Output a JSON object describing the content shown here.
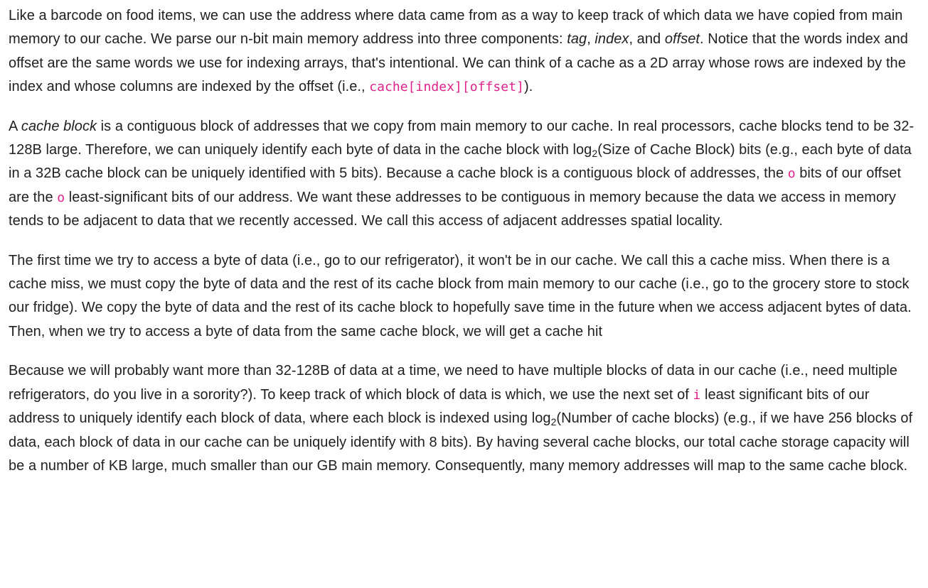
{
  "paragraphs": [
    {
      "p1_a": "Like a barcode on food items, we can use the address where data came from as a way to keep track of which data we have copied from main memory to our cache. We parse our n-bit main memory address into three components: ",
      "p1_tag": "tag",
      "p1_b": ", ",
      "p1_index": "index",
      "p1_c": ", and ",
      "p1_offset": "offset",
      "p1_d": ". Notice that the words index and offset are the same words we use for indexing arrays, that's intentional. We can think of a cache as a 2D array whose rows are indexed by the index and whose columns are indexed by the offset (i.e., ",
      "p1_code": "cache[index][offset]",
      "p1_e": ")."
    },
    {
      "p2_a": "A ",
      "p2_em": "cache block",
      "p2_b": " is a contiguous block of addresses that we copy from main memory to our cache. In real processors, cache blocks tend to be 32-128B large. Therefore, we can uniquely identify each byte of data in the cache block with log",
      "p2_sub": "2",
      "p2_c": "(Size of Cache Block) bits (e.g., each byte of data in a 32B cache block can be uniquely identified with 5 bits). Because a cache block is a contiguous block of addresses, the ",
      "p2_code1": "o",
      "p2_d": " bits of our offset are the ",
      "p2_code2": "o",
      "p2_e": " least-significant bits of our address. We want these addresses to be contiguous in memory because the data we access in memory tends to be adjacent to data that we recently accessed. We call this access of adjacent addresses spatial locality."
    },
    {
      "p3": "The first time we try to access a byte of data (i.e., go to our refrigerator), it won't be in our cache. We call this a cache miss. When there is a cache miss, we must copy the byte of data and the rest of its cache block from main memory to our cache (i.e., go to the grocery store to stock our fridge).  We copy the byte of data and the rest of its cache block to hopefully save time in the future when we access adjacent bytes of data. Then, when we try to access a byte of data from the same cache block, we will get a cache hit"
    },
    {
      "p4_a": "Because we will probably want more than 32-128B of data at a time, we need to have multiple blocks of data in our cache (i.e., need multiple refrigerators, do you live in a sorority?). To keep track of which block of data is which, we use the next set of ",
      "p4_code": "i",
      "p4_b": " least significant bits of our address to uniquely identify each block of data, where each block is indexed using log",
      "p4_sub": "2",
      "p4_c": "(Number of cache blocks) (e.g., if we have 256 blocks of data, each block of data in our cache can be uniquely identify with 8 bits). By having several cache blocks, our total cache storage capacity will be a number of KB large, much smaller than our GB main memory. Consequently, many memory addresses will map to the same cache block."
    }
  ],
  "colors": {
    "text": "#1f1f1f",
    "code": "#e0218a",
    "background": "#ffffff"
  }
}
